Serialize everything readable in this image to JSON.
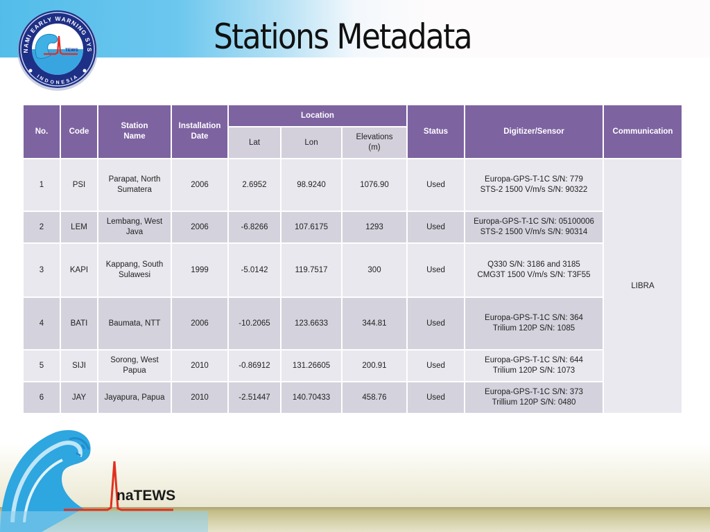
{
  "slide": {
    "title": "Stations Metadata",
    "logos": {
      "top": {
        "name": "Tsunami Early Warning System Indonesia",
        "ring_top": "TSUNAMI EARLY WARNING SYSTEM",
        "ring_bottom": "INDONESIA",
        "mark": "TEWS"
      },
      "bottom": {
        "mark": "naTEWS"
      }
    },
    "colors": {
      "header": "#7e63a1",
      "row_light": "#e9e8ee",
      "row_dark": "#d4d2dd",
      "banner": "#53bdea"
    }
  },
  "table": {
    "headers": {
      "no": "No.",
      "code": "Code",
      "station_name": [
        "Station",
        "Name"
      ],
      "installation_date": [
        "Installation",
        "Date"
      ],
      "location": "Location",
      "lat": "Lat",
      "lon": "Lon",
      "elevation": [
        "Elevations",
        "(m)"
      ],
      "status": "Status",
      "digitizer_sensor": "Digitizer/Sensor",
      "communication": "Communication"
    },
    "communication_value": "LIBRA",
    "rows": [
      {
        "no": "1",
        "code": "PSI",
        "name": [
          "Parapat, North",
          "Sumatera"
        ],
        "date": "2006",
        "lat": "2.6952",
        "lon": "98.9240",
        "elev": "1076.90",
        "status": "Used",
        "sensor": [
          "Europa-GPS-T-1C S/N: 779",
          "STS-2 1500 V/m/s S/N: 90322"
        ]
      },
      {
        "no": "2",
        "code": "LEM",
        "name": [
          "Lembang, West Java"
        ],
        "date": "2006",
        "lat": "-6.8266",
        "lon": "107.6175",
        "elev": "1293",
        "status": "Used",
        "sensor": [
          "Europa-GPS-T-1C S/N: 05100006",
          "STS-2 1500 V/m/s  S/N: 90314"
        ]
      },
      {
        "no": "3",
        "code": "KAPI",
        "name": [
          "Kappang, South",
          "Sulawesi"
        ],
        "date": "1999",
        "lat": "-5.0142",
        "lon": "119.7517",
        "elev": "300",
        "status": "Used",
        "sensor": [
          "Q330 S/N: 3186 and 3185",
          "CMG3T 1500 V/m/s S/N: T3F55"
        ]
      },
      {
        "no": "4",
        "code": "BATI",
        "name": [
          "Baumata, NTT"
        ],
        "date": "2006",
        "lat": "-10.2065",
        "lon": "123.6633",
        "elev": "344.81",
        "status": "Used",
        "sensor": [
          "Europa-GPS-T-1C S/N: 364",
          "Trilium 120P S/N: 1085"
        ]
      },
      {
        "no": "5",
        "code": "SIJI",
        "name": [
          "Sorong, West Papua"
        ],
        "date": "2010",
        "lat": "-0.86912",
        "lon": "131.26605",
        "elev": "200.91",
        "status": "Used",
        "sensor": [
          "Europa-GPS-T-1C  S/N: 644",
          "Trilium 120P  S/N: 1073"
        ]
      },
      {
        "no": "6",
        "code": "JAY",
        "name": [
          "Jayapura, Papua"
        ],
        "date": "2010",
        "lat": "-2.51447",
        "lon": "140.70433",
        "elev": "458.76",
        "status": "Used",
        "sensor": [
          "Europa-GPS-T-1C S/N: 373",
          "Trillium 120P S/N: 0480"
        ]
      }
    ]
  }
}
